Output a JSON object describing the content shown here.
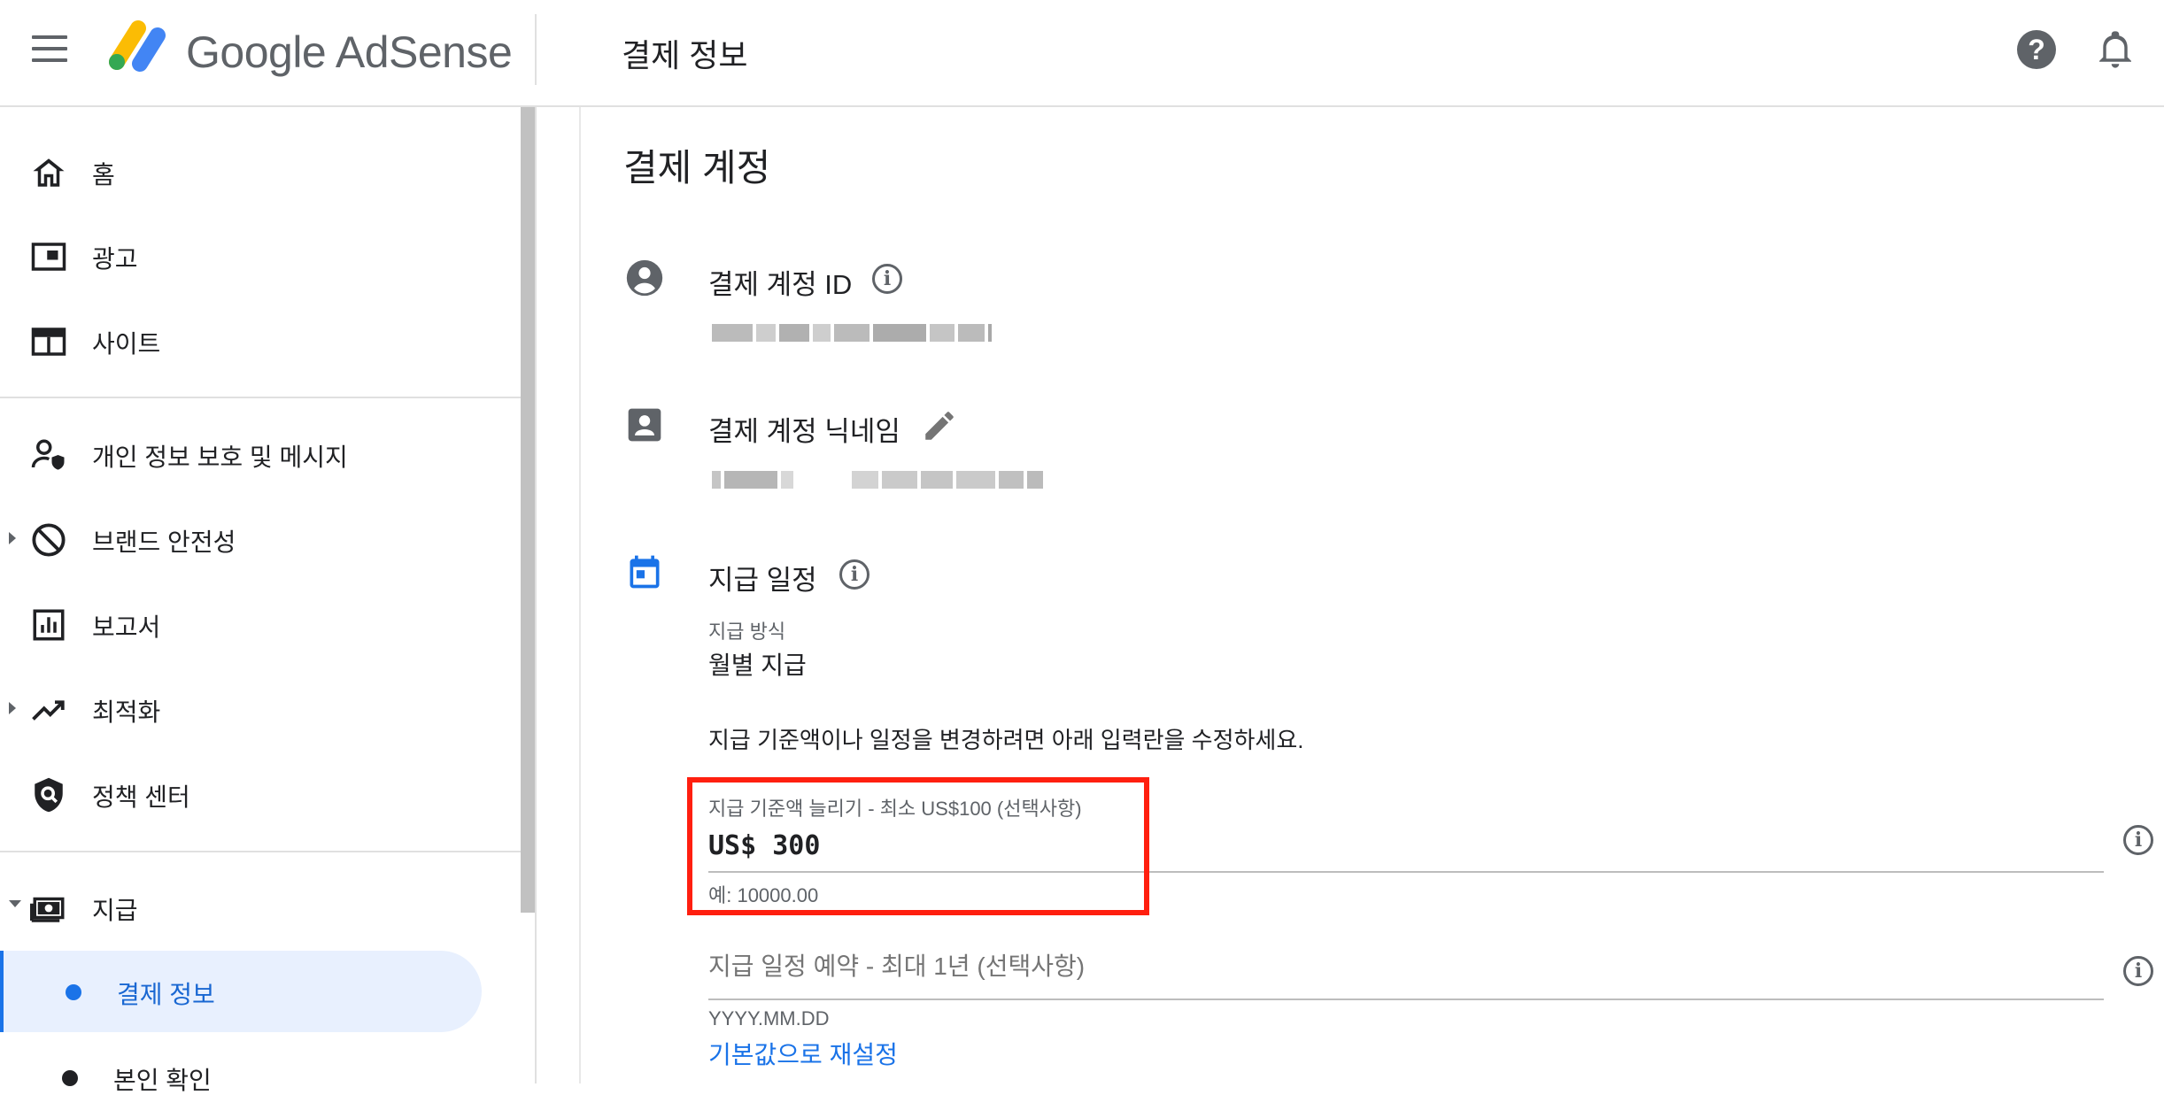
{
  "header": {
    "brand": "Google AdSense",
    "page_title": "결제 정보"
  },
  "sidebar": {
    "items": [
      {
        "label": "홈",
        "icon": "home-icon"
      },
      {
        "label": "광고",
        "icon": "ads-icon"
      },
      {
        "label": "사이트",
        "icon": "sites-icon"
      },
      {
        "label": "개인 정보 보호 및 메시지",
        "icon": "privacy-icon"
      },
      {
        "label": "브랜드 안전성",
        "icon": "block-icon"
      },
      {
        "label": "보고서",
        "icon": "reports-icon"
      },
      {
        "label": "최적화",
        "icon": "trending-icon"
      },
      {
        "label": "정책 센터",
        "icon": "policy-shield-icon"
      },
      {
        "label": "지급",
        "icon": "payments-icon"
      }
    ],
    "sub_items": [
      {
        "label": "결제 정보",
        "active": true
      },
      {
        "label": "본인 확인",
        "active": false
      }
    ]
  },
  "main": {
    "section_title": "결제 계정",
    "billing_id": {
      "title": "결제 계정 ID"
    },
    "nickname": {
      "title": "결제 계정 닉네임"
    },
    "schedule": {
      "title": "지급 일정",
      "method_label": "지급 방식",
      "method_value": "월별 지급",
      "instruction": "지급 기준액이나 일정을 변경하려면 아래 입력란을 수정하세요."
    },
    "threshold_field": {
      "label": "지급 기준액 늘리기 - 최소 US$100 (선택사항)",
      "value": "US$ 300",
      "hint": "예: 10000.00"
    },
    "date_field": {
      "placeholder": "지급 일정 예약 - 최대 1년 (선택사항)",
      "hint": "YYYY.MM.DD"
    },
    "reset_link": "기본값으로 재설정"
  },
  "colors": {
    "accent": "#1a73e8",
    "highlight_box": "#ff1f0f",
    "active_nav_bg": "#e8f0fe"
  }
}
